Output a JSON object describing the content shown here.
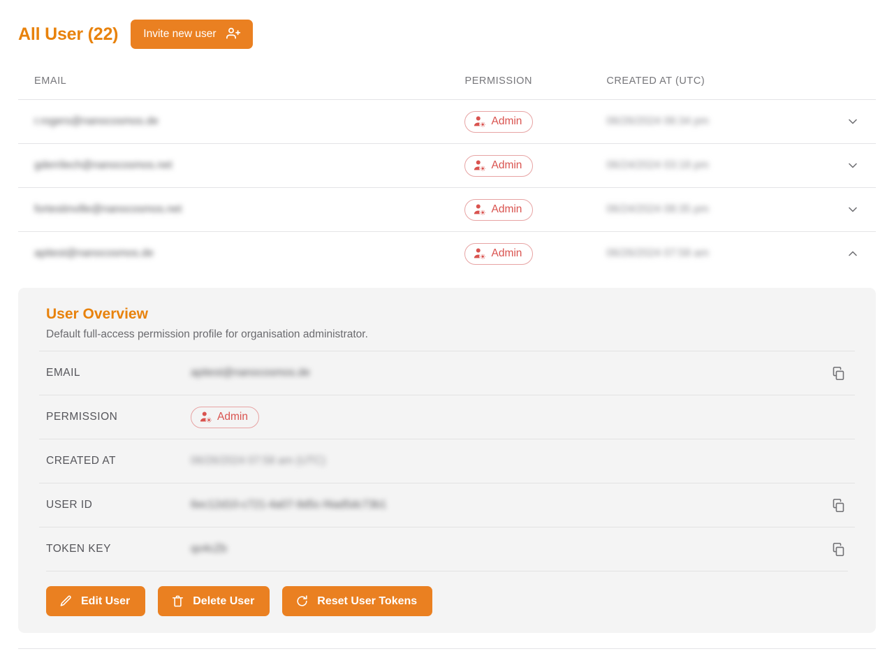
{
  "header": {
    "title": "All User (22)",
    "invite_button": "Invite new user",
    "invite_icon": "user-plus-icon"
  },
  "table": {
    "columns": [
      "EMAIL",
      "PERMISSION",
      "CREATED AT (UTC)"
    ],
    "rows": [
      {
        "email": "r.rogers@nanocosmos.de",
        "permission": "Admin",
        "created_at": "06/26/2024 06:34 pm",
        "expanded": false,
        "chevron": "chevron-down-icon"
      },
      {
        "email": "gderrilech@nanocosmos.net",
        "permission": "Admin",
        "created_at": "06/24/2024 03:18 pm",
        "expanded": false,
        "chevron": "chevron-down-icon"
      },
      {
        "email": "fortestinville@nanocosmos.net",
        "permission": "Admin",
        "created_at": "06/24/2024 08:35 pm",
        "expanded": false,
        "chevron": "chevron-down-icon"
      },
      {
        "email": "apitest@nanocosmos.de",
        "permission": "Admin",
        "created_at": "06/26/2024 07:58 am",
        "expanded": true,
        "chevron": "chevron-up-icon"
      }
    ]
  },
  "overview": {
    "title": "User Overview",
    "subtitle": "Default full-access permission profile for organisation administrator.",
    "details": [
      {
        "label": "EMAIL",
        "value": "apitest@nanocosmos.de",
        "copyable": true,
        "type": "text"
      },
      {
        "label": "PERMISSION",
        "value": "Admin",
        "copyable": false,
        "type": "badge"
      },
      {
        "label": "CREATED AT",
        "value": "06/26/2024 07:58 am (UTC)",
        "copyable": false,
        "type": "text"
      },
      {
        "label": "USER ID",
        "value": "6ec12d10-c721-4a07-9d5c-f4ad5dc73b1",
        "copyable": true,
        "type": "text"
      },
      {
        "label": "TOKEN KEY",
        "value": "qo4cZb",
        "copyable": true,
        "type": "text"
      }
    ],
    "actions": [
      {
        "label": "Edit User",
        "icon": "pencil-icon"
      },
      {
        "label": "Delete User",
        "icon": "trash-icon"
      },
      {
        "label": "Reset User Tokens",
        "icon": "refresh-icon"
      }
    ]
  },
  "colors": {
    "accent_orange": "#EA8021",
    "badge_red": "#d9534f",
    "badge_border": "#e7a3a3",
    "panel_bg": "#f4f4f4",
    "divider": "#e4e4e6",
    "label_gray": "#76767a"
  }
}
